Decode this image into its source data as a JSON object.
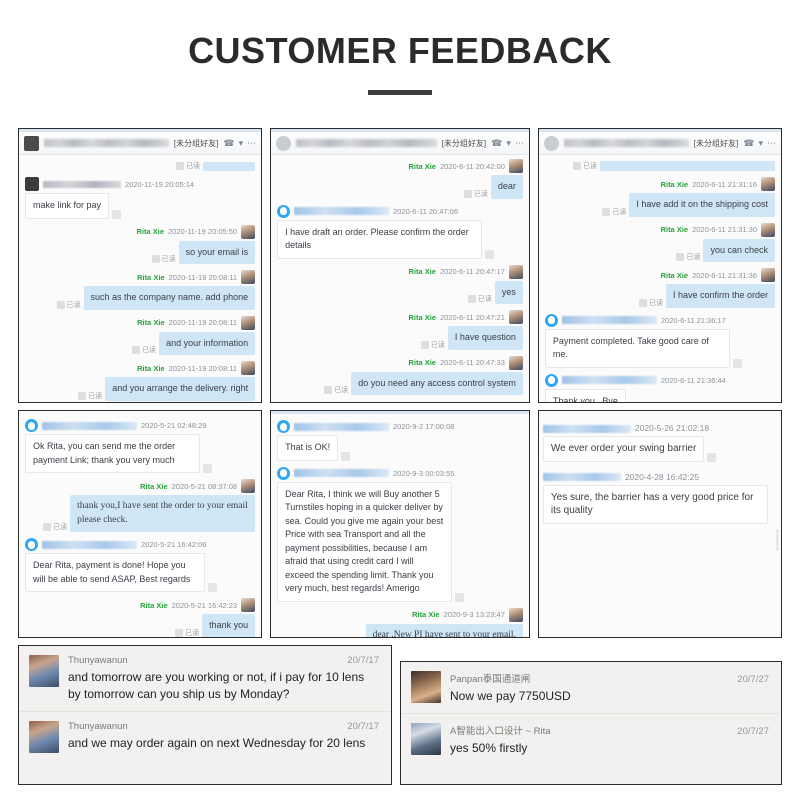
{
  "header": {
    "title": "CUSTOMER FEEDBACK"
  },
  "labels": {
    "group_tag": "[未分组好友]",
    "read_mark": "已读",
    "rita": "Rita Xie",
    "phone_icon": "phone-call-icon",
    "chevron_icon": "chevron-down-icon",
    "more_icon": "more-horizontal-icon"
  },
  "panels": [
    {
      "id": "panel-1",
      "messages": [
        {
          "side": "out",
          "who": "",
          "time": "",
          "text": "",
          "partial": true
        },
        {
          "side": "in",
          "who": "",
          "time": "2020-11-19 20:05:14",
          "text": "make link for pay"
        },
        {
          "side": "out",
          "who": "Rita Xie",
          "time": "2020-11-19 20:05:50",
          "text": "so your email is"
        },
        {
          "side": "out",
          "who": "Rita Xie",
          "time": "2020-11-19 20:08:11",
          "text": "such as the company name. add phone"
        },
        {
          "side": "out",
          "who": "Rita Xie",
          "time": "2020-11-19 20:08:11",
          "text": "and your information"
        },
        {
          "side": "out",
          "who": "Rita Xie",
          "time": "2020-11-19 20:08:11",
          "text": "and you arrange the delivery. right"
        }
      ]
    },
    {
      "id": "panel-2",
      "messages": [
        {
          "side": "out",
          "who": "Rita Xie",
          "time": "2020-6-11 20:42:00",
          "text": "dear"
        },
        {
          "side": "in",
          "who": "",
          "time": "2020-6-11 20:47:06",
          "text": "I have draft an order. Please confirm the order details"
        },
        {
          "side": "out",
          "who": "Rita Xie",
          "time": "2020-6-11 20:47:17",
          "text": "yes"
        },
        {
          "side": "out",
          "who": "Rita Xie",
          "time": "2020-6-11 20:47:21",
          "text": "I have question"
        },
        {
          "side": "out",
          "who": "Rita Xie",
          "time": "2020-6-11 20:47:33",
          "text": "do you need any access control system"
        }
      ]
    },
    {
      "id": "panel-3",
      "messages": [
        {
          "side": "out",
          "who": "",
          "time": "",
          "text": "",
          "partial": true
        },
        {
          "side": "out",
          "who": "Rita Xie",
          "time": "2020-6-11 21:31:16",
          "text": "I have add it on the shipping cost"
        },
        {
          "side": "out",
          "who": "Rita Xie",
          "time": "2020-6-11 21:31:30",
          "text": "you can check"
        },
        {
          "side": "out",
          "who": "Rita Xie",
          "time": "2020-6-11 21:31:36",
          "text": "I have confirm the order"
        },
        {
          "side": "in",
          "who": "",
          "time": "2020-6-11 21:36:17",
          "text": "Payment completed. Take good care of me."
        },
        {
          "side": "in",
          "who": "",
          "time": "2020-6-11 21:36:44",
          "text": "Thank you . Bye"
        }
      ]
    },
    {
      "id": "panel-4",
      "messages": [
        {
          "side": "in",
          "who": "",
          "time": "2020-5-21 02:48:29",
          "text": "Ok Rita, you can send me the order payment Link; thank you very much"
        },
        {
          "side": "out",
          "who": "Rita Xie",
          "time": "2020-5-21 08:37:08",
          "text": "thank you,I have sent the order to your email please check."
        },
        {
          "side": "in",
          "who": "",
          "time": "2020-5-21 16:42:06",
          "text": "Dear Rita, payment is done! Hope you will be able to send ASAP, Best regards"
        },
        {
          "side": "out",
          "who": "Rita Xie",
          "time": "2020-5-21 16:42:23",
          "text": "thank you"
        }
      ]
    },
    {
      "id": "panel-5",
      "messages": [
        {
          "side": "in",
          "who": "",
          "time": "2020-9-2 17:00:08",
          "text": "That is OK!"
        },
        {
          "side": "in",
          "who": "",
          "time": "2020-9-3 00:03:55",
          "text": "Dear Rita, I think we will Buy another 5 Turnstiles hoping in a quicker deliver by sea. Could you give me again your best Price with sea Transport and all the payment possibilities, because I am afraid that using credit card I will exceed the spending limit. Thank you very much, best regards! Amerigo"
        },
        {
          "side": "out",
          "who": "Rita Xie",
          "time": "2020-9-3 13:23:47",
          "text": "dear ,New PI have sent to your email."
        }
      ]
    },
    {
      "id": "panel-6",
      "messages": [
        {
          "side": "in",
          "who": "",
          "time": "2020-5-26 21:02:18",
          "text": "We ever order your swing barrier"
        },
        {
          "side": "in",
          "who": "",
          "time": "2020-4-28 16:42:25",
          "text": "Yes sure, the barrier has a very good price for its quality"
        }
      ]
    }
  ],
  "bottom_cards": [
    {
      "id": "card-left",
      "entries": [
        {
          "name": "Thunyawanun",
          "date": "20/7/17",
          "text": "and tomorrow are you working or not, if i pay for 10 lens by tomorrow can you ship us by Monday?"
        },
        {
          "name": "Thunyawanun",
          "date": "20/7/17",
          "text": "and we may order again on next Wednesday for 20 lens"
        }
      ]
    },
    {
      "id": "card-right",
      "entries": [
        {
          "name": "Panpan泰国通道闸",
          "date": "20/7/27",
          "text": "Now we pay 7750USD"
        },
        {
          "name": "A智能出入口设计 ~ Rita",
          "date": "20/7/27",
          "text": "yes 50% firstly"
        }
      ]
    }
  ],
  "colors": {
    "title": "#2b2b2b",
    "outgoing_bubble": "#cfe6f7",
    "incoming_bubble": "#ffffff",
    "sender_name": "#27a23a",
    "panel_border": "#2c2c2c"
  }
}
